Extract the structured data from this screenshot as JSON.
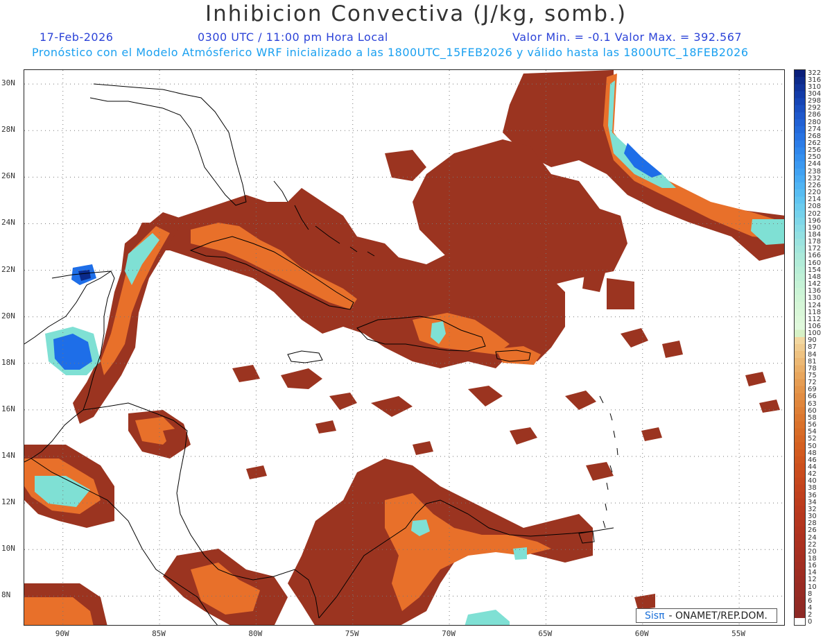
{
  "header": {
    "title": "Inhibicion Convectiva (J/kg, somb.)",
    "date": "17-Feb-2026",
    "time": "0300 UTC / 11:00 pm Hora Local",
    "minmax": "Valor Min. = -0.1  Valor Max. = 392.567",
    "model": "Pronóstico con el Modelo Atmósferico WRF inicializado a las 1800UTC_15FEB2026 y válido hasta las  1800UTC_18FEB2026"
  },
  "map": {
    "lon_range": [
      -92,
      -52.6
    ],
    "lat_range": [
      6.7,
      30.6
    ],
    "lat_ticks": [
      {
        "label": "30N",
        "value": 30
      },
      {
        "label": "28N",
        "value": 28
      },
      {
        "label": "26N",
        "value": 26
      },
      {
        "label": "24N",
        "value": 24
      },
      {
        "label": "22N",
        "value": 22
      },
      {
        "label": "20N",
        "value": 20
      },
      {
        "label": "18N",
        "value": 18
      },
      {
        "label": "16N",
        "value": 16
      },
      {
        "label": "14N",
        "value": 14
      },
      {
        "label": "12N",
        "value": 12
      },
      {
        "label": "10N",
        "value": 10
      },
      {
        "label": "8N",
        "value": 8
      }
    ],
    "lon_ticks": [
      {
        "label": "90W",
        "value": -90
      },
      {
        "label": "85W",
        "value": -85
      },
      {
        "label": "80W",
        "value": -80
      },
      {
        "label": "75W",
        "value": -75
      },
      {
        "label": "70W",
        "value": -70
      },
      {
        "label": "65W",
        "value": -65
      },
      {
        "label": "60W",
        "value": -60
      },
      {
        "label": "55W",
        "value": -55
      }
    ],
    "colors": {
      "low": "#9b3420",
      "mid": "#e8702a",
      "high": "#7fe0d4",
      "peak": "#1e6ee8",
      "max": "#0a2a8c",
      "coast": "#000000"
    }
  },
  "colorbar": {
    "labels": [
      "322",
      "316",
      "310",
      "304",
      "298",
      "292",
      "286",
      "280",
      "274",
      "268",
      "262",
      "256",
      "250",
      "244",
      "238",
      "232",
      "226",
      "220",
      "214",
      "208",
      "202",
      "196",
      "190",
      "184",
      "178",
      "172",
      "166",
      "160",
      "154",
      "148",
      "142",
      "136",
      "130",
      "124",
      "118",
      "112",
      "106",
      "100",
      "90",
      "87",
      "84",
      "81",
      "78",
      "75",
      "72",
      "69",
      "66",
      "63",
      "60",
      "58",
      "56",
      "54",
      "52",
      "50",
      "48",
      "46",
      "44",
      "42",
      "40",
      "38",
      "36",
      "34",
      "32",
      "30",
      "28",
      "26",
      "24",
      "22",
      "20",
      "18",
      "16",
      "14",
      "12",
      "10",
      "8",
      "6",
      "4",
      "2",
      "0"
    ],
    "colors": [
      "#0a1f7a",
      "#0d2a8a",
      "#10339a",
      "#133ca8",
      "#1645b5",
      "#1a4fc1",
      "#1e58cb",
      "#2161d4",
      "#246adb",
      "#2873e2",
      "#2c7de8",
      "#3087ec",
      "#3590ef",
      "#3b99f1",
      "#41a2f2",
      "#48abf3",
      "#50b4f3",
      "#58bdf2",
      "#61c5f1",
      "#6bccef",
      "#75d2ec",
      "#7fd7e9",
      "#89dce6",
      "#92e0e2",
      "#9be3df",
      "#a3e6dc",
      "#abe9da",
      "#b2ecd8",
      "#b9eed7",
      "#bff0d6",
      "#c5f2d6",
      "#cbf4d6",
      "#d0f5d6",
      "#d5f6d7",
      "#d9f7d8",
      "#ddf8da",
      "#e0f9dc",
      "#d6f1c6",
      "#f2d7a0",
      "#f0cc90",
      "#eec281",
      "#ecb874",
      "#eaaf68",
      "#e8a65d",
      "#e69d53",
      "#e4954a",
      "#e28d43",
      "#e0863c",
      "#de7f36",
      "#dc7830",
      "#da722b",
      "#d86c27",
      "#d66624",
      "#d46021",
      "#d25a1f",
      "#cf551e",
      "#cc501d",
      "#c94b1d",
      "#c6471d",
      "#c3431d",
      "#c0401d",
      "#bd3d1d",
      "#ba3a1e",
      "#b7381e",
      "#b4361f",
      "#b1341f",
      "#ae3220",
      "#ab3120",
      "#a83021",
      "#a52f21",
      "#a22e22",
      "#9f2d22",
      "#9c2c23",
      "#992b23",
      "#962b24",
      "#932a24",
      "#902a25",
      "#8d2925",
      "#ffffff"
    ]
  },
  "credit": {
    "brand": "Sisπ",
    "text": "- ONAMET/REP.DOM."
  }
}
